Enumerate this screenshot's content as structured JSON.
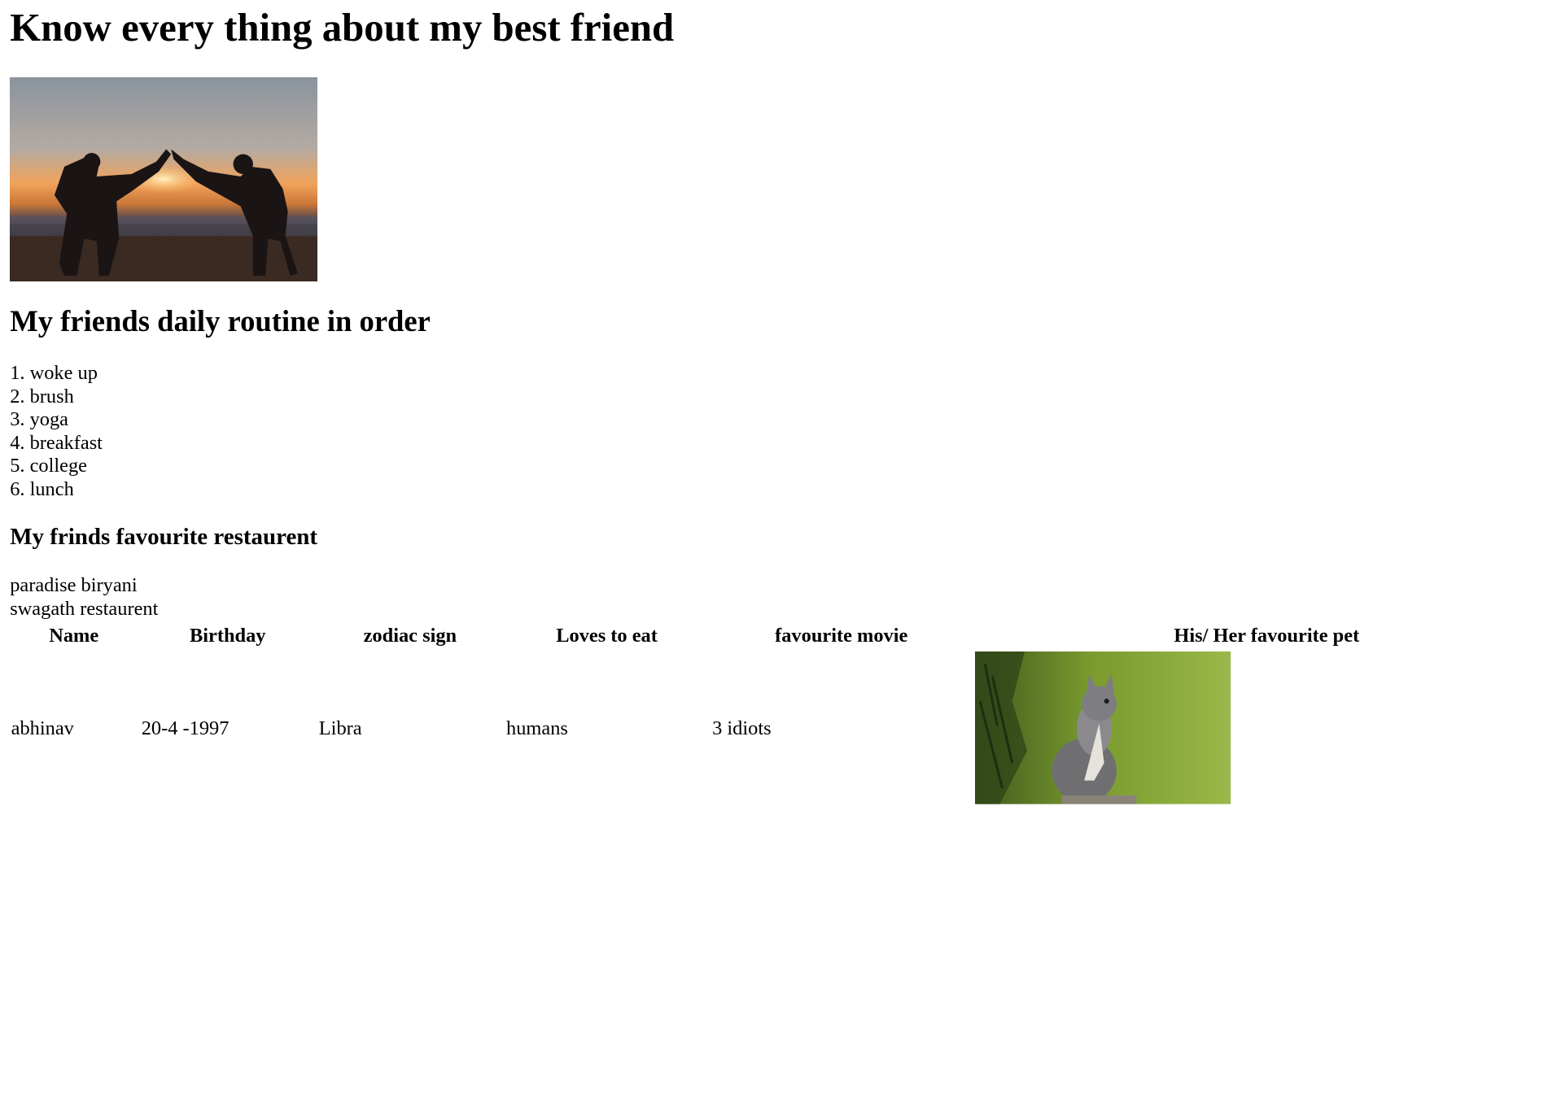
{
  "page": {
    "title": "Know every thing about my best friend"
  },
  "routine": {
    "heading": "My friends daily routine in order",
    "items": [
      "woke up",
      "brush",
      "yoga",
      "breakfast",
      "college",
      "lunch"
    ]
  },
  "restaurants": {
    "heading": "My frinds favourite restaurent",
    "items": [
      "paradise biryani",
      "swagath restaurent"
    ]
  },
  "table": {
    "headers": [
      "Name",
      "Birthday",
      "zodiac sign",
      "Loves to eat",
      "favourite movie",
      "His/ Her favourite pet"
    ],
    "row": {
      "name": "abhinav",
      "birthday": "20-4 -1997",
      "zodiac": "Libra",
      "loves_to_eat": "humans",
      "movie": "3 idiots"
    }
  }
}
